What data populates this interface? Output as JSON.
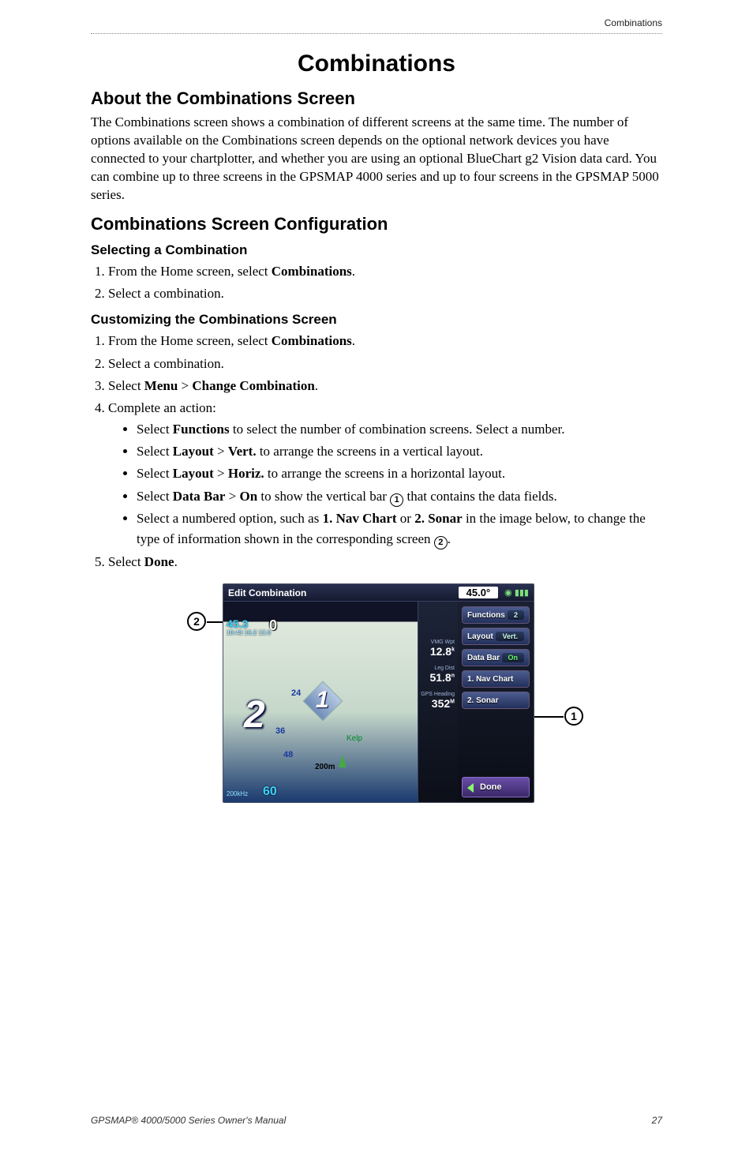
{
  "header": {
    "right": "Combinations"
  },
  "title": "Combinations",
  "s1": {
    "h": "About the Combinations Screen",
    "p": "The Combinations screen shows a combination of different screens at the same time. The number of options available on the Combinations screen depends on the optional network devices you have connected to your chartplotter, and whether you are using an optional BlueChart g2 Vision data card. You can combine up to three screens in the GPSMAP 4000 series and up to four screens in the GPSMAP 5000 series."
  },
  "s2": {
    "h": "Combinations Screen Configuration",
    "sub1": {
      "h": "Selecting a Combination",
      "step1_pre": "From the Home screen, select ",
      "step1_b": "Combinations",
      "step1_post": ".",
      "step2": "Select a combination."
    },
    "sub2": {
      "h": "Customizing the Combinations Screen",
      "step1_pre": "From the Home screen, select ",
      "step1_b": "Combinations",
      "step1_post": ".",
      "step2": "Select a combination.",
      "step3_pre": "Select ",
      "step3_b1": "Menu",
      "step3_mid": " > ",
      "step3_b2": "Change Combination",
      "step3_post": ".",
      "step4": "Complete an action:",
      "b1_pre": "Select ",
      "b1_b": "Functions",
      "b1_post": " to select the number of combination screens. Select a number.",
      "b2_pre": "Select ",
      "b2_b1": "Layout",
      "b2_mid": " > ",
      "b2_b2": "Vert.",
      "b2_post": " to arrange the screens in a vertical layout.",
      "b3_pre": "Select ",
      "b3_b1": "Layout",
      "b3_mid": " > ",
      "b3_b2": "Horiz.",
      "b3_post": " to arrange the screens in a horizontal layout.",
      "b4_pre": "Select ",
      "b4_b1": "Data Bar",
      "b4_mid": " > ",
      "b4_b2": "On",
      "b4_post1": " to show the vertical bar ",
      "b4_c": "➀",
      "b4_post2": " that contains the data fields.",
      "b5_pre": "Select a numbered option, such as ",
      "b5_b1": "1. Nav Chart",
      "b5_mid": " or ",
      "b5_b2": "2. Sonar",
      "b5_post1": " in the image below, to change the type of information shown in the corresponding screen ",
      "b5_c": "➁",
      "b5_post2": ".",
      "step5_pre": "Select ",
      "step5_b": "Done",
      "step5_post": "."
    }
  },
  "device": {
    "title": "Edit Combination",
    "heading_deg": "45.0",
    "depth": "45.3",
    "depth_sub": "10:43\n16.2\n13.0",
    "zero": "0",
    "one_label": "1",
    "two_label": "2",
    "n24": "24",
    "n36": "36",
    "n48": "48",
    "kelp": "Kelp",
    "scale": "200m",
    "sixty": "60",
    "bottom_left": "200kHz",
    "data_fields": [
      {
        "lbl": "VMG Wpt",
        "val": "12.8"
      },
      {
        "lbl": "Leg Dist",
        "val": "51.8"
      },
      {
        "lbl": "GPS Heading",
        "val": "352"
      }
    ],
    "menu": {
      "functions": {
        "label": "Functions",
        "value": "2"
      },
      "layout": {
        "label": "Layout",
        "value": "Vert."
      },
      "databar": {
        "label": "Data Bar",
        "value": "On"
      },
      "opt1": "1. Nav Chart",
      "opt2": "2. Sonar",
      "done": "Done"
    }
  },
  "footer": {
    "left": "GPSMAP® 4000/5000 Series Owner's Manual",
    "page": "27"
  },
  "callouts": {
    "c1": "1",
    "c2": "2"
  }
}
